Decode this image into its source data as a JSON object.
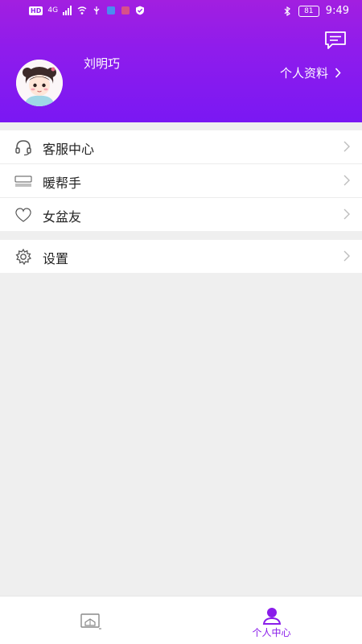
{
  "status_bar": {
    "hd": "HD",
    "network": "4G",
    "battery": "81",
    "time": "9:49"
  },
  "header": {
    "username": "刘明巧",
    "profile_link": "个人资料",
    "message_icon": "message-icon",
    "avatar_icon": "avatar"
  },
  "menu": {
    "group1": [
      {
        "label": "客服中心",
        "icon": "headset-icon"
      },
      {
        "label": "暖帮手",
        "icon": "warm-helper-icon"
      },
      {
        "label": "女盆友",
        "icon": "heart-icon"
      }
    ],
    "group2": [
      {
        "label": "设置",
        "icon": "gear-icon"
      }
    ]
  },
  "tabbar": {
    "home_icon": "home-box-icon",
    "me_label": "个人中心",
    "me_icon": "person-icon",
    "active_color": "#8a1dea"
  },
  "colors": {
    "header_top": "#a21fe0",
    "header_bottom": "#7a18f3",
    "background": "#efefef"
  }
}
